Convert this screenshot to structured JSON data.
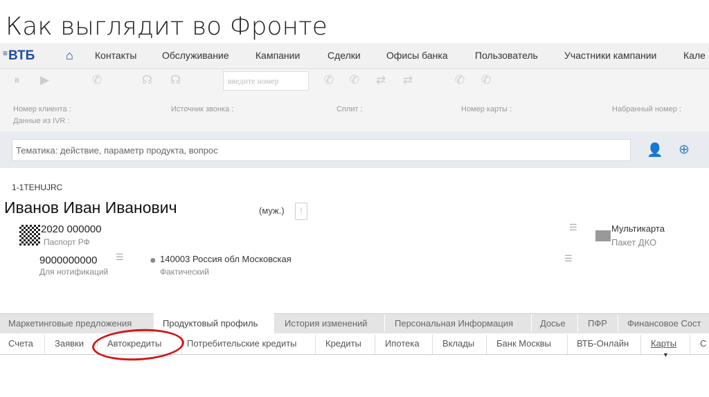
{
  "slide_title": "Как выглядит во Фронте",
  "logo": "ВТБ",
  "nav": [
    "Контакты",
    "Обслуживание",
    "Кампании",
    "Сделки",
    "Офисы банка",
    "Пользователь",
    "Участники кампании",
    "Кале"
  ],
  "toolbar": {
    "number_placeholder": "введите номер"
  },
  "call_info": {
    "client_number": "Номер клиента :",
    "ivr": "Данные из IVR :",
    "call_source": "Источник звонка :",
    "split": "Сплит :",
    "card_number": "Номер карты :",
    "dialed_number": "Набранный номер :"
  },
  "topic_placeholder": "Тематика: действие, параметр продукта, вопрос",
  "client": {
    "id": "1-1TEHUJRC",
    "name": "Иванов Иван Иванович",
    "gender": "(муж.)",
    "doc_number": "2020 000000",
    "doc_type": "Паспорт РФ",
    "phone": "9000000000",
    "phone_type": "Для нотификаций",
    "address": "140003 Россия обл Московская",
    "address_type": "Фактический",
    "product": "Мультикарта",
    "package": "Пакет ДКО"
  },
  "tabs": [
    "Маркетинговые предложения",
    "Продуктовый профиль",
    "История изменений",
    "Персональная Информация",
    "Досье",
    "ПФР",
    "Финансовое Сост"
  ],
  "subtabs": [
    "Счета",
    "Заявки",
    "Автокредиты",
    "Потребительские кредиты",
    "Кредиты",
    "Ипотека",
    "Вклады",
    "Банк Москвы",
    "ВТБ-Онлайн",
    "Карты",
    "С"
  ]
}
